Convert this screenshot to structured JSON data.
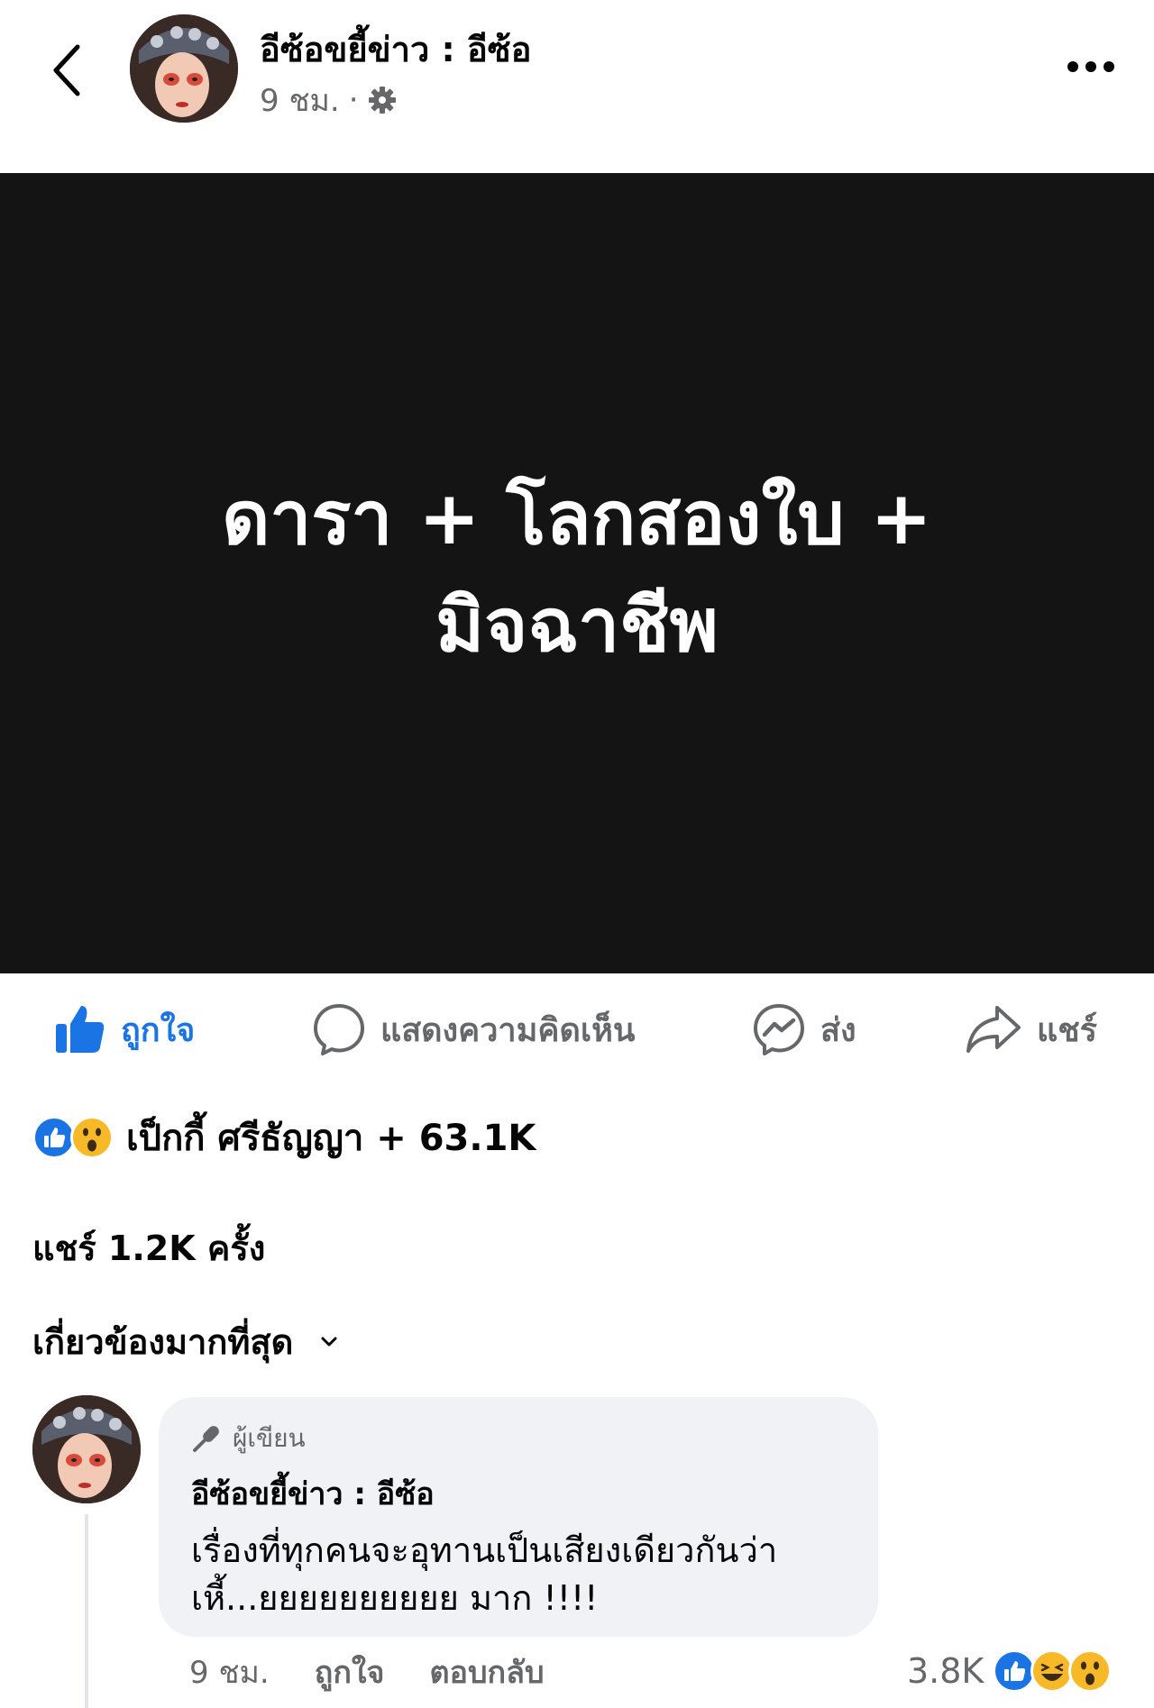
{
  "post": {
    "page_name": "อีซ้อขยี้ข่าว : อีซ้อ",
    "time": "9 ชม.",
    "separator": "·",
    "image_text_line1": "ดารา + โลกสองใบ +",
    "image_text_line2": "มิจฉาชีพ"
  },
  "actions": {
    "like": "ถูกใจ",
    "comment": "แสดงความคิดเห็น",
    "send": "ส่ง",
    "share": "แชร์"
  },
  "reactions": {
    "summary": "เป็กกี้ ศรีธัญญา + 63.1K",
    "icons": [
      "like-icon",
      "wow-icon"
    ]
  },
  "shares": {
    "text": "แชร์ 1.2K ครั้ง"
  },
  "sort": {
    "label": "เกี่ยวข้องมากที่สุด"
  },
  "comment": {
    "badge": "ผู้เขียน",
    "author": "อีซ้อขยี้ข่าว : อีซ้อ",
    "text_line1": "เรื่องที่ทุกคนจะอุทานเป็นเสียงเดียวกันว่า",
    "text_line2": "เหี้...ยยยยยยยยยย มาก !!!!",
    "time": "9 ชม.",
    "like": "ถูกใจ",
    "reply": "ตอบกลับ",
    "reaction_count": "3.8K",
    "reaction_icons": [
      "like-icon",
      "haha-icon",
      "wow-icon"
    ]
  },
  "colors": {
    "accent": "#1b74e4",
    "secondary_text": "#65676b",
    "bubble_bg": "#f0f2f5",
    "post_image_bg": "#141414"
  }
}
